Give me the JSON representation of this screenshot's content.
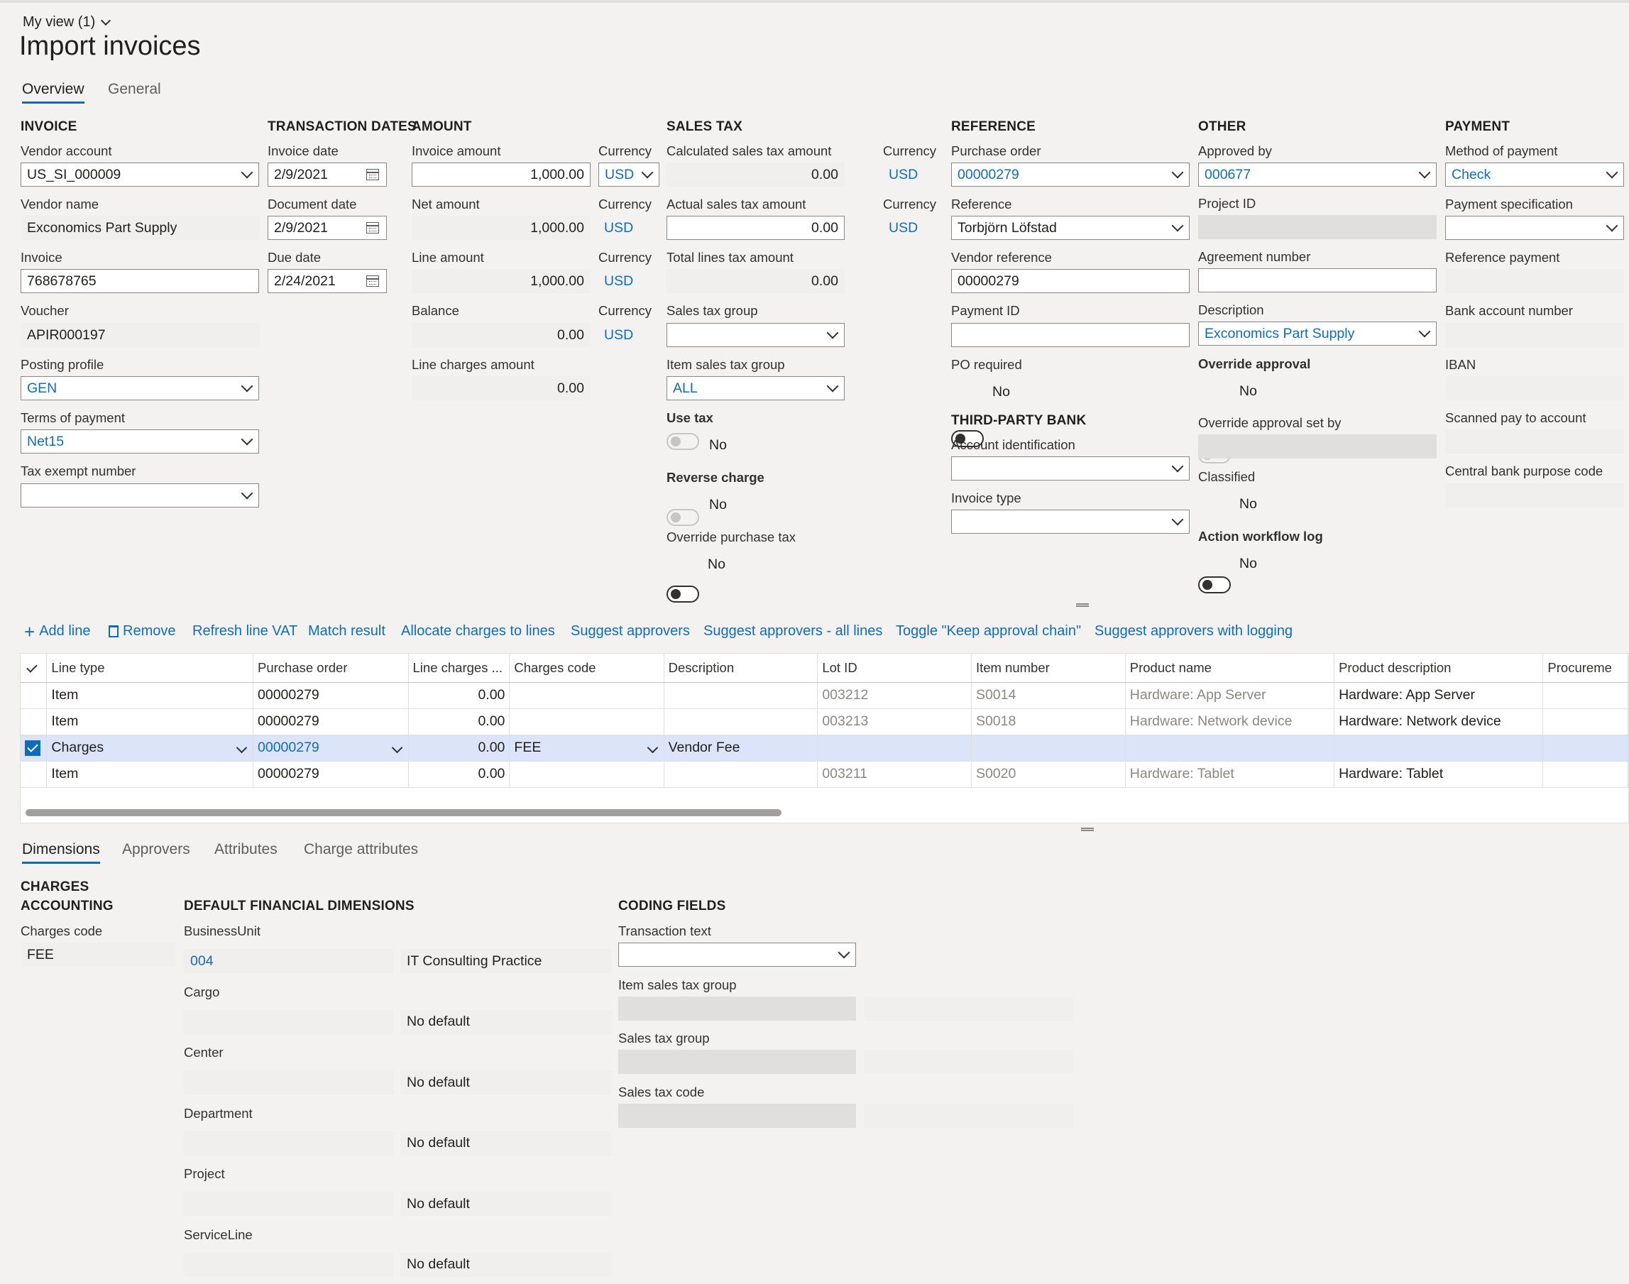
{
  "view_label": "My view (1)",
  "page_title": "Import invoices",
  "tabs": [
    "Overview",
    "General"
  ],
  "invoice": {
    "header": "INVOICE",
    "vendor_account_label": "Vendor account",
    "vendor_account": "US_SI_000009",
    "vendor_name_label": "Vendor name",
    "vendor_name": "Exconomics Part Supply",
    "invoice_label": "Invoice",
    "invoice": "768678765",
    "voucher_label": "Voucher",
    "voucher": "APIR000197",
    "posting_profile_label": "Posting profile",
    "posting_profile": "GEN",
    "terms_label": "Terms of payment",
    "terms": "Net15",
    "tax_exempt_label": "Tax exempt number",
    "tax_exempt": ""
  },
  "dates": {
    "header": "TRANSACTION DATES",
    "invoice_date_label": "Invoice date",
    "invoice_date": "2/9/2021",
    "document_date_label": "Document date",
    "document_date": "2/9/2021",
    "due_date_label": "Due date",
    "due_date": "2/24/2021"
  },
  "amount": {
    "header": "AMOUNT",
    "invoice_amount_label": "Invoice amount",
    "invoice_amount": "1,000.00",
    "net_amount_label": "Net amount",
    "net_amount": "1,000.00",
    "line_amount_label": "Line amount",
    "line_amount": "1,000.00",
    "balance_label": "Balance",
    "balance": "0.00",
    "line_charges_label": "Line charges amount",
    "line_charges": "0.00",
    "currency_label": "Currency",
    "currency": "USD"
  },
  "sales_tax": {
    "header": "SALES TAX",
    "calc_label": "Calculated sales tax amount",
    "calc": "0.00",
    "actual_label": "Actual sales tax amount",
    "actual": "0.00",
    "total_lines_label": "Total lines tax amount",
    "total_lines": "0.00",
    "group_label": "Sales tax group",
    "group": "",
    "item_group_label": "Item sales tax group",
    "item_group": "ALL",
    "use_tax_label": "Use tax",
    "use_tax": "No",
    "reverse_label": "Reverse charge",
    "reverse": "No",
    "override_label": "Override purchase tax",
    "override": "No",
    "currency_label": "Currency",
    "currency": "USD"
  },
  "reference": {
    "header": "REFERENCE",
    "po_label": "Purchase order",
    "po": "00000279",
    "reference_label": "Reference",
    "reference": "Torbjörn Löfstad",
    "vendor_ref_label": "Vendor reference",
    "vendor_ref": "00000279",
    "payment_id_label": "Payment ID",
    "payment_id": "",
    "po_required_label": "PO required",
    "po_required": "No"
  },
  "third_party": {
    "header": "THIRD-PARTY BANK",
    "account_label": "Account identification",
    "account": "",
    "invoice_type_label": "Invoice type",
    "invoice_type": ""
  },
  "other": {
    "header": "OTHER",
    "approved_by_label": "Approved by",
    "approved_by": "000677",
    "project_label": "Project ID",
    "agreement_label": "Agreement number",
    "description_label": "Description",
    "description": "Exconomics Part Supply",
    "override_label": "Override approval",
    "override": "No",
    "override_set_label": "Override approval set by",
    "classified_label": "Classified",
    "classified": "No",
    "workflow_label": "Action workflow log",
    "workflow": "No"
  },
  "payment": {
    "header": "PAYMENT",
    "method_label": "Method of payment",
    "method": "Check",
    "spec_label": "Payment specification",
    "ref_label": "Reference payment",
    "bank_label": "Bank account number",
    "iban_label": "IBAN",
    "scanned_label": "Scanned pay to account",
    "central_label": "Central bank purpose code"
  },
  "actions": {
    "add_line": "Add line",
    "remove": "Remove",
    "refresh_vat": "Refresh line VAT",
    "match": "Match result",
    "allocate": "Allocate charges to lines",
    "suggest": "Suggest approvers",
    "suggest_all": "Suggest approvers - all lines",
    "toggle_chain": "Toggle \"Keep approval chain\"",
    "suggest_log": "Suggest approvers with logging"
  },
  "grid": {
    "columns": [
      "Line type",
      "Purchase order",
      "Line charges ...",
      "Charges code",
      "Description",
      "Lot ID",
      "Item number",
      "Product name",
      "Product description",
      "Procureme"
    ],
    "rows": [
      {
        "type": "Item",
        "po": "00000279",
        "charges": "0.00",
        "code": "",
        "desc": "",
        "lot": "003212",
        "item": "S0014",
        "product": "Hardware: App Server",
        "pdesc": "Hardware: App Server"
      },
      {
        "type": "Item",
        "po": "00000279",
        "charges": "0.00",
        "code": "",
        "desc": "",
        "lot": "003213",
        "item": "S0018",
        "product": "Hardware: Network device",
        "pdesc": "Hardware: Network device"
      },
      {
        "type": "Charges",
        "po": "00000279",
        "charges": "0.00",
        "code": "FEE",
        "desc": "Vendor Fee",
        "lot": "",
        "item": "",
        "product": "",
        "pdesc": ""
      },
      {
        "type": "Item",
        "po": "00000279",
        "charges": "0.00",
        "code": "",
        "desc": "",
        "lot": "003211",
        "item": "S0020",
        "product": "Hardware: Tablet",
        "pdesc": "Hardware: Tablet"
      }
    ]
  },
  "bottom_tabs": [
    "Dimensions",
    "Approvers",
    "Attributes",
    "Charge attributes"
  ],
  "charges_accounting": {
    "header1": "CHARGES",
    "header2": "ACCOUNTING",
    "code_label": "Charges code",
    "code": "FEE"
  },
  "fin_dims": {
    "header": "DEFAULT FINANCIAL DIMENSIONS",
    "items": [
      {
        "label": "BusinessUnit",
        "value": "004",
        "desc": "IT Consulting Practice"
      },
      {
        "label": "Cargo",
        "value": "",
        "desc": "No default"
      },
      {
        "label": "Center",
        "value": "",
        "desc": "No default"
      },
      {
        "label": "Department",
        "value": "",
        "desc": "No default"
      },
      {
        "label": "Project",
        "value": "",
        "desc": "No default"
      },
      {
        "label": "ServiceLine",
        "value": "",
        "desc": "No default"
      }
    ]
  },
  "coding": {
    "header": "CODING FIELDS",
    "trans_text_label": "Transaction text",
    "item_tax_label": "Item sales tax group",
    "tax_group_label": "Sales tax group",
    "tax_code_label": "Sales tax code"
  },
  "colors": {
    "accent": "#0f6cbd",
    "selected_row": "#dbe4f9",
    "background": "#f3f2f1"
  }
}
